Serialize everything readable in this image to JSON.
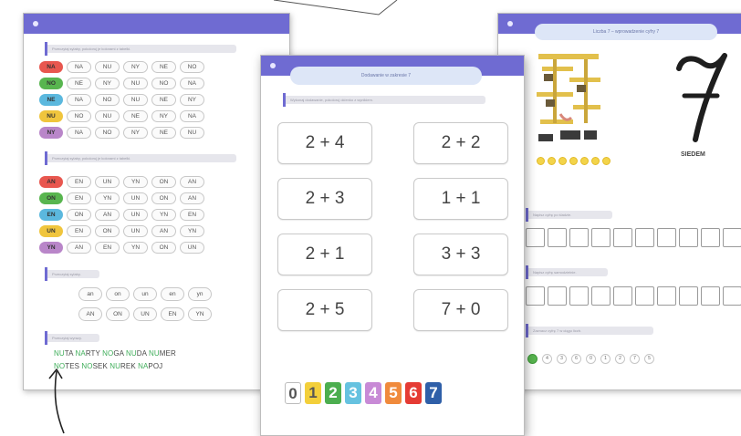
{
  "left_sheet": {
    "instruction_1": "Przeczytaj sylaby, pokoloruj je kolorami z tabelki.",
    "instruction_2": "Przeczytaj sylaby, pokoloruj je kolorami z tabelki.",
    "instruction_3": "Przeczytaj sylaby.",
    "instruction_4": "Przeczytaj wyrazy.",
    "grid1": [
      {
        "tag": "NA",
        "color": "#e8574f",
        "cells": [
          "NA",
          "NU",
          "NY",
          "NE",
          "NO"
        ]
      },
      {
        "tag": "NO",
        "color": "#58b54f",
        "cells": [
          "NE",
          "NY",
          "NU",
          "NO",
          "NA"
        ]
      },
      {
        "tag": "NE",
        "color": "#5bb8de",
        "cells": [
          "NA",
          "NO",
          "NU",
          "NE",
          "NY"
        ]
      },
      {
        "tag": "NU",
        "color": "#f0c53d",
        "cells": [
          "NO",
          "NU",
          "NE",
          "NY",
          "NA"
        ]
      },
      {
        "tag": "NY",
        "color": "#b986c9",
        "cells": [
          "NA",
          "NO",
          "NY",
          "NE",
          "NU"
        ]
      }
    ],
    "grid2": [
      {
        "tag": "AN",
        "color": "#e8574f",
        "cells": [
          "EN",
          "UN",
          "YN",
          "ON",
          "AN"
        ]
      },
      {
        "tag": "ON",
        "color": "#58b54f",
        "cells": [
          "EN",
          "YN",
          "UN",
          "ON",
          "AN"
        ]
      },
      {
        "tag": "EN",
        "color": "#5bb8de",
        "cells": [
          "ON",
          "AN",
          "UN",
          "YN",
          "EN"
        ]
      },
      {
        "tag": "UN",
        "color": "#f0c53d",
        "cells": [
          "EN",
          "ON",
          "UN",
          "AN",
          "YN"
        ]
      },
      {
        "tag": "YN",
        "color": "#b986c9",
        "cells": [
          "AN",
          "EN",
          "YN",
          "ON",
          "UN"
        ]
      }
    ],
    "syl_row1": [
      "an",
      "on",
      "un",
      "en",
      "yn"
    ],
    "syl_row2": [
      "AN",
      "ON",
      "UN",
      "EN",
      "YN"
    ],
    "words_line1": [
      {
        "pre": "",
        "hl": "NU",
        "post": "TA"
      },
      {
        "pre": "",
        "hl": "NA",
        "post": "RTY"
      },
      {
        "pre": "",
        "hl": "NO",
        "post": "GA"
      },
      {
        "pre": "",
        "hl": "NU",
        "post": "DA"
      },
      {
        "pre": "",
        "hl": "NU",
        "post": "MER"
      }
    ],
    "words_line2": [
      {
        "pre": "",
        "hl": "NO",
        "post": "TES"
      },
      {
        "pre": "",
        "hl": "NO",
        "post": "SEK"
      },
      {
        "pre": "",
        "hl": "NU",
        "post": "REK"
      },
      {
        "pre": "",
        "hl": "NA",
        "post": "POJ"
      }
    ]
  },
  "middle_sheet": {
    "title": "Dodawanie w zakresie 7",
    "instruction": "Wykonaj dodawanie, pokoloruj okienko z wynikiem.",
    "equations": [
      "2 + 4",
      "2 + 2",
      "2 + 3",
      "1 + 1",
      "2 + 1",
      "3 + 3",
      "2 + 5",
      "7 + 0"
    ],
    "numbers": [
      {
        "n": "0",
        "bg": "#ffffff",
        "fg": "#555555"
      },
      {
        "n": "1",
        "bg": "#f3cf3a",
        "fg": "#555555"
      },
      {
        "n": "2",
        "bg": "#4cae4f",
        "fg": "#ffffff"
      },
      {
        "n": "3",
        "bg": "#66c2e0",
        "fg": "#ffffff"
      },
      {
        "n": "4",
        "bg": "#c88ad6",
        "fg": "#ffffff"
      },
      {
        "n": "5",
        "bg": "#f08a3c",
        "fg": "#ffffff"
      },
      {
        "n": "6",
        "bg": "#e53b34",
        "fg": "#ffffff"
      },
      {
        "n": "7",
        "bg": "#2f5fa8",
        "fg": "#ffffff"
      }
    ]
  },
  "right_sheet": {
    "title": "Liczba 7 – wprowadzenie cyfry 7",
    "digit": "7",
    "word": "SIEDEM",
    "instruction_1": "Napisz cyfrę po śladzie.",
    "instruction_2": "Napisz cyfrę samodzielnie.",
    "instruction_3": "Zaznacz cyfrę 7 w ciągu liczb.",
    "sequence": [
      "4",
      "3",
      "6",
      "0",
      "1",
      "2",
      "7",
      "5"
    ]
  }
}
